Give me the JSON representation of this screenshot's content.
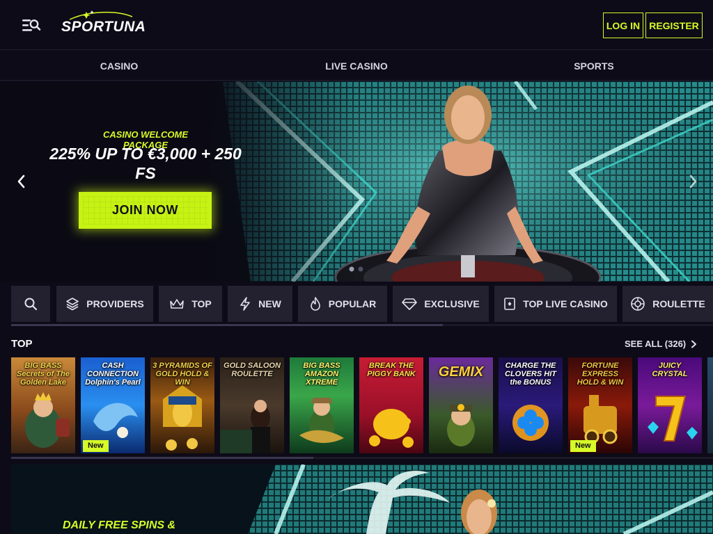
{
  "header": {
    "logo_text": "SPORTUNA",
    "login_label": "LOG IN",
    "register_label": "REGISTER",
    "accent_color": "#d7fb27"
  },
  "nav": {
    "items": [
      {
        "label": "CASINO"
      },
      {
        "label": "LIVE CASINO"
      },
      {
        "label": "SPORTS"
      }
    ]
  },
  "hero": {
    "subtitle": "CASINO WELCOME PACKAGE",
    "title": "225% UP TO €3,000 + 250 FS",
    "cta_label": "JOIN NOW",
    "slide_count": 2
  },
  "filters": {
    "items": [
      {
        "label": "",
        "icon": "search-icon"
      },
      {
        "label": "PROVIDERS",
        "icon": "layers-icon"
      },
      {
        "label": "TOP",
        "icon": "crown-icon"
      },
      {
        "label": "NEW",
        "icon": "lightning-icon"
      },
      {
        "label": "POPULAR",
        "icon": "flame-icon"
      },
      {
        "label": "EXCLUSIVE",
        "icon": "diamond-icon"
      },
      {
        "label": "TOP LIVE CASINO",
        "icon": "card-icon"
      },
      {
        "label": "ROULETTE",
        "icon": "roulette-icon"
      }
    ]
  },
  "top_section": {
    "title": "TOP",
    "see_all_label": "SEE ALL (326)",
    "games": [
      {
        "name": "BIG BASS Secrets of The Golden Lake",
        "badge": ""
      },
      {
        "name": "CASH CONNECTION Dolphin's Pearl",
        "badge": "New"
      },
      {
        "name": "3 PYRAMIDS OF GOLD HOLD & WIN",
        "badge": ""
      },
      {
        "name": "GOLD SALOON ROULETTE",
        "badge": ""
      },
      {
        "name": "BIG BASS AMAZON XTREME",
        "badge": ""
      },
      {
        "name": "BREAK THE PIGGY BANK",
        "badge": ""
      },
      {
        "name": "GEMIX",
        "badge": ""
      },
      {
        "name": "CHARGE THE CLOVERS HIT the BONUS",
        "badge": ""
      },
      {
        "name": "FORTUNE EXPRESS HOLD & WIN",
        "badge": "New"
      },
      {
        "name": "JUICY CRYSTAL",
        "badge": ""
      },
      {
        "name": "",
        "badge": ""
      }
    ]
  },
  "banner2": {
    "title": "DAILY FREE SPINS &"
  }
}
